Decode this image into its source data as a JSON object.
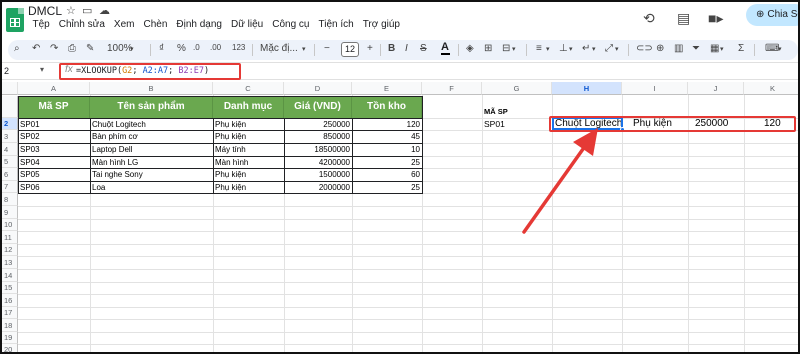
{
  "title_bar": {
    "doc_title": "DMCL",
    "menu": [
      "Tệp",
      "Chỉnh sửa",
      "Xem",
      "Chèn",
      "Định dạng",
      "Dữ liệu",
      "Công cụ",
      "Tiện ích",
      "Trợ giúp"
    ],
    "share_label": "Chia Sẻ"
  },
  "toolbar": {
    "zoom": "100%",
    "currency": "₫",
    "percent": "%",
    "decimal_decrease": ".0",
    "decimal_increase": ".00",
    "number_format": "123",
    "font_name": "Mặc đị...",
    "font_size": "12"
  },
  "formula_bar": {
    "cell_ref": "2",
    "fx": "fx",
    "formula_prefix": "=XLOOKUP(",
    "arg1": "G2",
    "sep1": "; ",
    "arg2": "A2:A7",
    "sep2": "; ",
    "arg3": "B2:E7",
    "formula_suffix": ")"
  },
  "grid": {
    "columns": [
      "A",
      "B",
      "C",
      "D",
      "E",
      "F",
      "G",
      "H",
      "I",
      "J",
      "K"
    ],
    "selected_column": "H",
    "rows": [
      "",
      "2",
      "3",
      "4",
      "5",
      "6",
      "7",
      "8",
      "9",
      "10",
      "11",
      "12",
      "13",
      "14",
      "15",
      "16",
      "17",
      "18",
      "19",
      "20"
    ],
    "selected_row": "2"
  },
  "table": {
    "headers": [
      "Mã SP",
      "Tên sản phẩm",
      "Danh mục",
      "Giá (VND)",
      "Tồn kho"
    ],
    "rows": [
      [
        "SP01",
        "Chuột Logitech",
        "Phụ kiện",
        "250000",
        "120"
      ],
      [
        "SP02",
        "Bàn phím cơ",
        "Phụ kiện",
        "850000",
        "45"
      ],
      [
        "SP03",
        "Laptop Dell",
        "Máy tính",
        "18500000",
        "10"
      ],
      [
        "SP04",
        "Màn hình LG",
        "Màn hình",
        "4200000",
        "25"
      ],
      [
        "SP05",
        "Tai nghe Sony",
        "Phụ kiện",
        "1500000",
        "60"
      ],
      [
        "SP06",
        "Loa",
        "Phụ kiện",
        "2000000",
        "25"
      ]
    ]
  },
  "lookup": {
    "label": "MÃ SP",
    "input": "SP01",
    "result": [
      "Chuột Logitech",
      "Phụ kiện",
      "250000",
      "120"
    ]
  },
  "colors": {
    "header_green": "#6aa84f",
    "selection_blue": "#1a73e8",
    "annotation_red": "#e53935",
    "share_button": "#c2e7ff"
  }
}
